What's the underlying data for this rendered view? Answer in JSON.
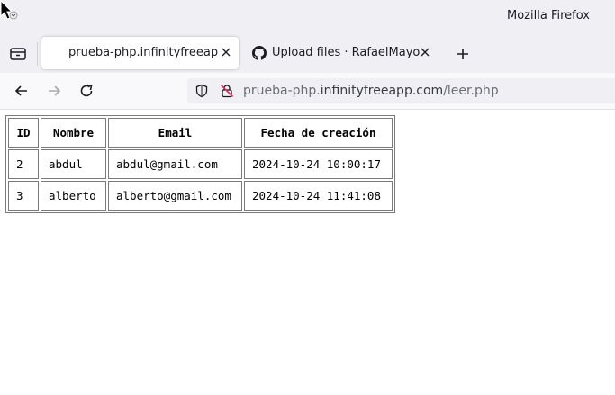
{
  "window": {
    "app_title": "Mozilla Firefox"
  },
  "tabs": [
    {
      "label": "prueba-php.infinityfreeapp.com",
      "active": true,
      "icon": "none"
    },
    {
      "label": "Upload files · RafaelMayor/DAW",
      "active": false,
      "icon": "github-icon"
    }
  ],
  "urlbar": {
    "url_prefix": "prueba-php.",
    "url_domain": "infinityfreeapp.com",
    "url_path": "/leer.php"
  },
  "table": {
    "headers": [
      "ID",
      "Nombre",
      "Email",
      "Fecha de creación"
    ],
    "rows": [
      [
        "2",
        "abdul",
        "abdul@gmail.com",
        "2024-10-24 10:00:17"
      ],
      [
        "3",
        "alberto",
        "alberto@gmail.com",
        "2024-10-24 11:41:08"
      ]
    ]
  },
  "colors": {
    "chrome_bg": "#f0f0f4",
    "text": "#1c1b22"
  }
}
